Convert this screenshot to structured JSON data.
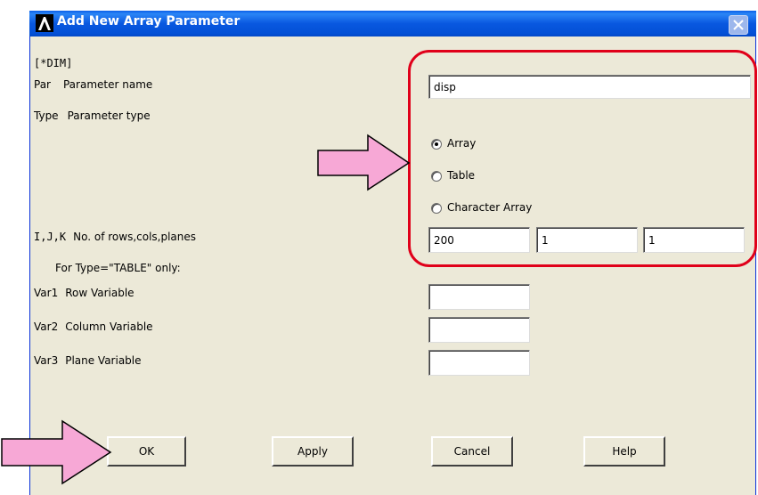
{
  "window": {
    "title": "Add New Array Parameter"
  },
  "command": "[*DIM]",
  "fields": {
    "par": {
      "code": "Par",
      "desc": "Parameter name",
      "value": "disp"
    },
    "type": {
      "code": "Type",
      "desc": "Parameter type",
      "options": [
        "Array",
        "Table",
        "Character Array"
      ],
      "selected": "Array"
    },
    "dims": {
      "code": "I,J,K",
      "desc": "No. of rows,cols,planes",
      "values": [
        "200",
        "1",
        "1"
      ]
    },
    "table_note": "For Type=\"TABLE\" only:",
    "var1": {
      "code": "Var1",
      "desc": "Row Variable",
      "value": ""
    },
    "var2": {
      "code": "Var2",
      "desc": "Column Variable",
      "value": ""
    },
    "var3": {
      "code": "Var3",
      "desc": "Plane Variable",
      "value": ""
    }
  },
  "buttons": {
    "ok": "OK",
    "apply": "Apply",
    "cancel": "Cancel",
    "help": "Help"
  },
  "colors": {
    "titlebar": "#0a5ee8",
    "dialog_bg": "#ece9d8",
    "highlight": "#e0001a",
    "arrow_fill": "#f7a8d6"
  },
  "icons": {
    "logo": "ansys-logo-icon",
    "close": "close-icon",
    "arrow": "pointer-arrow-icon"
  }
}
